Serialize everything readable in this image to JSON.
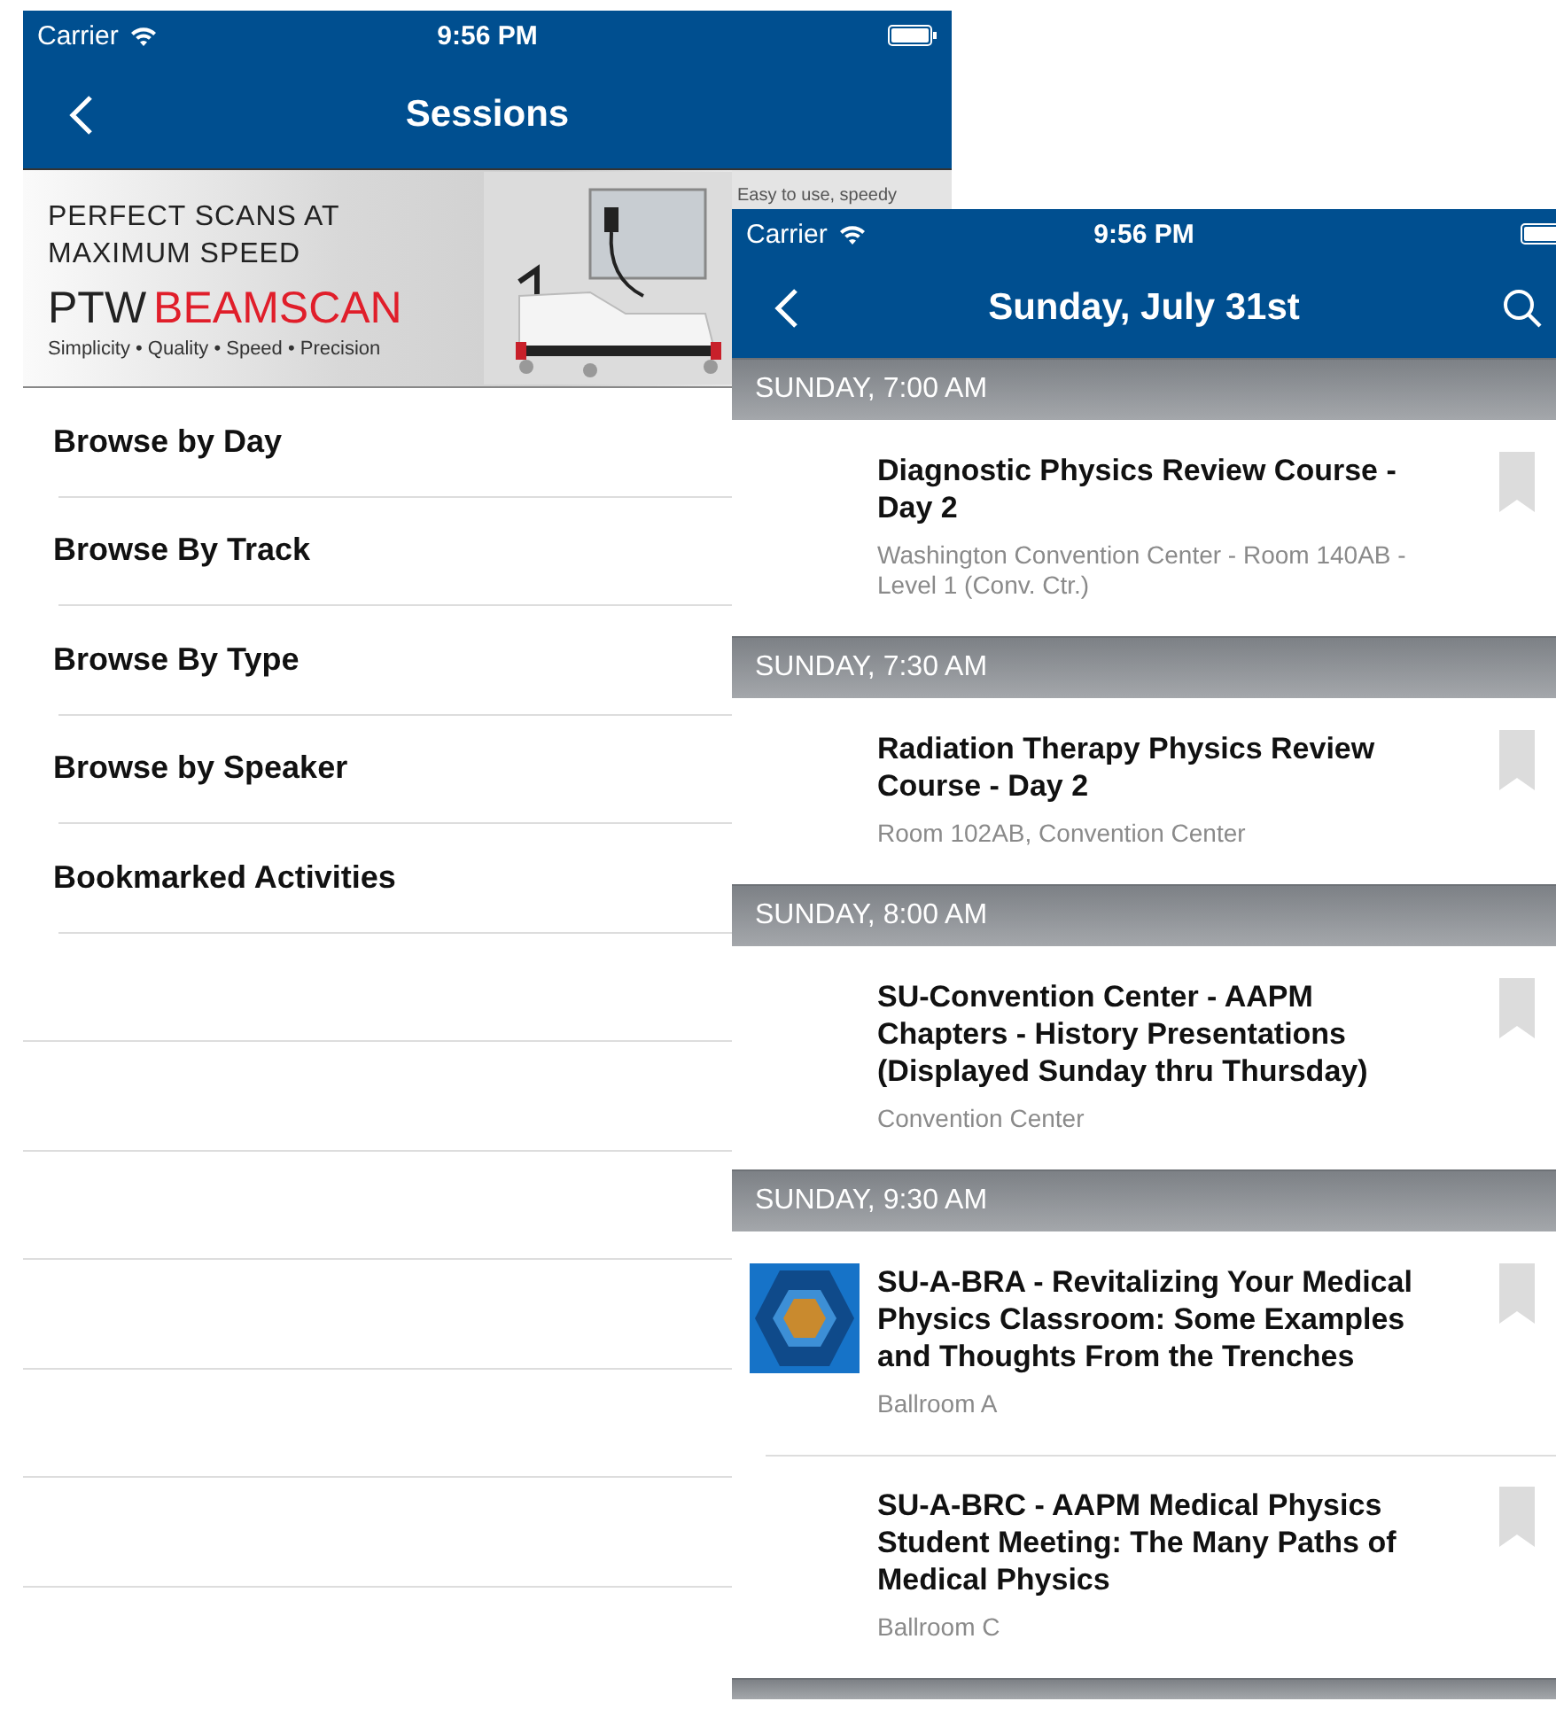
{
  "sessions_screen": {
    "status_bar": {
      "carrier": "Carrier",
      "time": "9:56 PM"
    },
    "title": "Sessions",
    "banner": {
      "headline": [
        "PERFECT SCANS AT",
        "MAXIMUM SPEED"
      ],
      "brand_prefix": "PTW",
      "brand": "BEAMSCAN",
      "tagline": "Simplicity • Quality • Speed • Precision",
      "side_text": "Easy to use, speedy"
    },
    "menu": [
      {
        "label": "Browse by Day"
      },
      {
        "label": "Browse By Track"
      },
      {
        "label": "Browse By Type"
      },
      {
        "label": "Browse by Speaker"
      },
      {
        "label": "Bookmarked Activities"
      }
    ]
  },
  "day_screen": {
    "status_bar": {
      "carrier": "Carrier",
      "time": "9:56 PM"
    },
    "title": "Sunday, July 31st",
    "sections": [
      {
        "header": "SUNDAY, 7:00 AM",
        "sessions": [
          {
            "title": "Diagnostic Physics Review Course - Day 2",
            "location": "Washington Convention Center - Room 140AB - Level 1 (Conv. Ctr.)",
            "logo": false,
            "bookmarked": false
          }
        ]
      },
      {
        "header": "SUNDAY, 7:30 AM",
        "sessions": [
          {
            "title": "Radiation Therapy Physics Review Course - Day 2",
            "location": "Room 102AB, Convention Center",
            "logo": false,
            "bookmarked": false
          }
        ]
      },
      {
        "header": "SUNDAY, 8:00 AM",
        "sessions": [
          {
            "title": "SU-Convention Center - AAPM Chapters - History Presentations (Displayed Sunday thru Thursday)",
            "location": "Convention Center",
            "logo": false,
            "bookmarked": false
          }
        ]
      },
      {
        "header": "SUNDAY, 9:30 AM",
        "sessions": [
          {
            "title": "SU-A-BRA - Revitalizing Your Medical Physics Classroom: Some Examples and Thoughts From the Trenches",
            "location": "Ballroom A",
            "logo": true,
            "bookmarked": false
          },
          {
            "title": "SU-A-BRC - AAPM Medical Physics Student Meeting: The Many Paths of Medical Physics",
            "location": "Ballroom C",
            "logo": false,
            "bookmarked": false
          }
        ]
      }
    ]
  }
}
